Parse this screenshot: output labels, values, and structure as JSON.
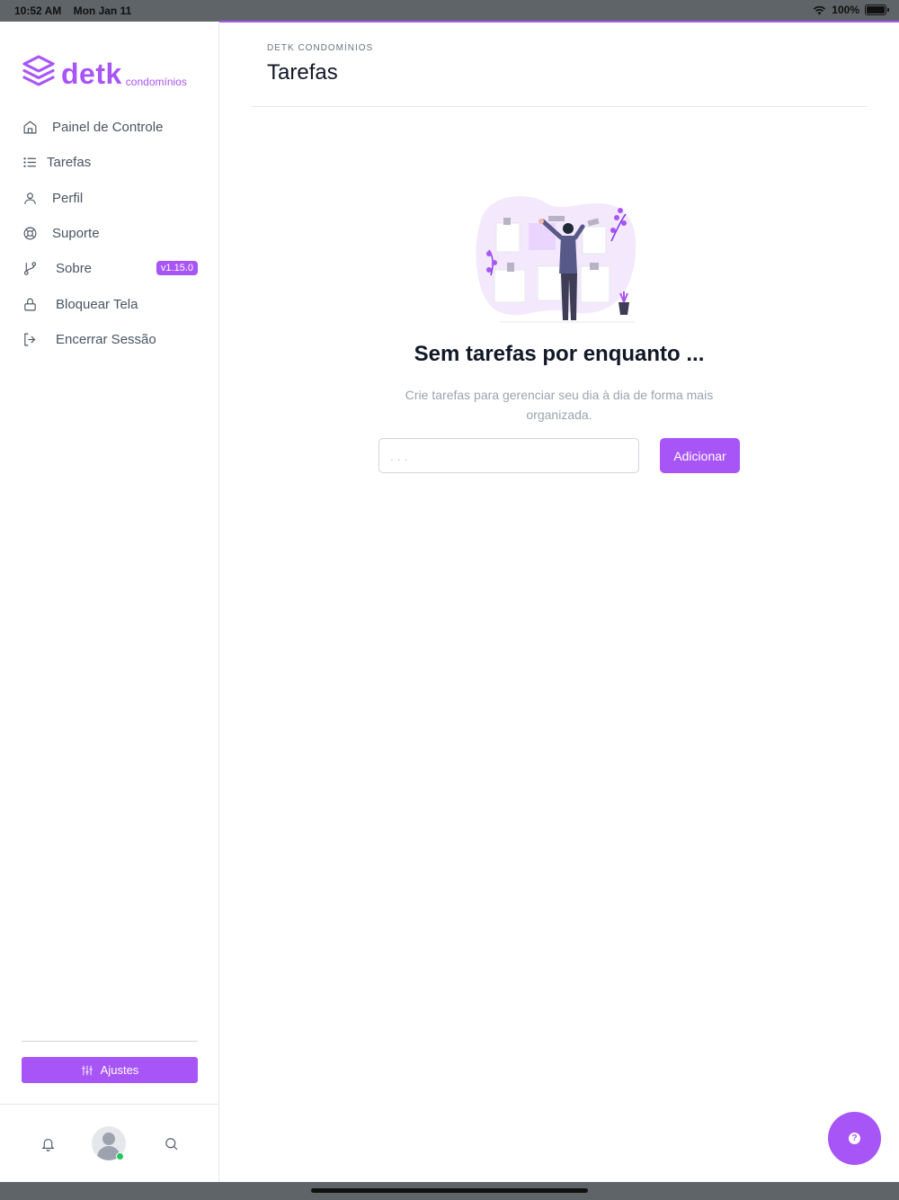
{
  "status_bar": {
    "time": "10:52 AM",
    "date": "Mon Jan 11",
    "battery": "100%"
  },
  "brand": {
    "name": "detk",
    "subtitle": "condomínios",
    "color": "#a855f7"
  },
  "sidebar": {
    "items": [
      {
        "label": "Painel de Controle",
        "icon": "home-icon"
      },
      {
        "label": "Tarefas",
        "icon": "list-icon"
      },
      {
        "label": "Perfil",
        "icon": "user-icon"
      },
      {
        "label": "Suporte",
        "icon": "lifebuoy-icon"
      },
      {
        "label": "Sobre",
        "icon": "git-branch-icon",
        "badge": "v1.15.0"
      },
      {
        "label": "Bloquear Tela",
        "icon": "lock-icon"
      },
      {
        "label": "Encerrar Sessão",
        "icon": "logout-icon"
      }
    ],
    "settings_label": "Ajustes"
  },
  "header": {
    "breadcrumb": "DETK CONDOMÍNIOS",
    "title": "Tarefas"
  },
  "empty_state": {
    "title": "Sem tarefas por enquanto ...",
    "description": "Crie tarefas para gerenciar seu dia à dia de forma mais organizada."
  },
  "task_form": {
    "placeholder": ". . .",
    "value": "",
    "submit_label": "Adicionar"
  },
  "help_button": {
    "glyph": "?"
  }
}
